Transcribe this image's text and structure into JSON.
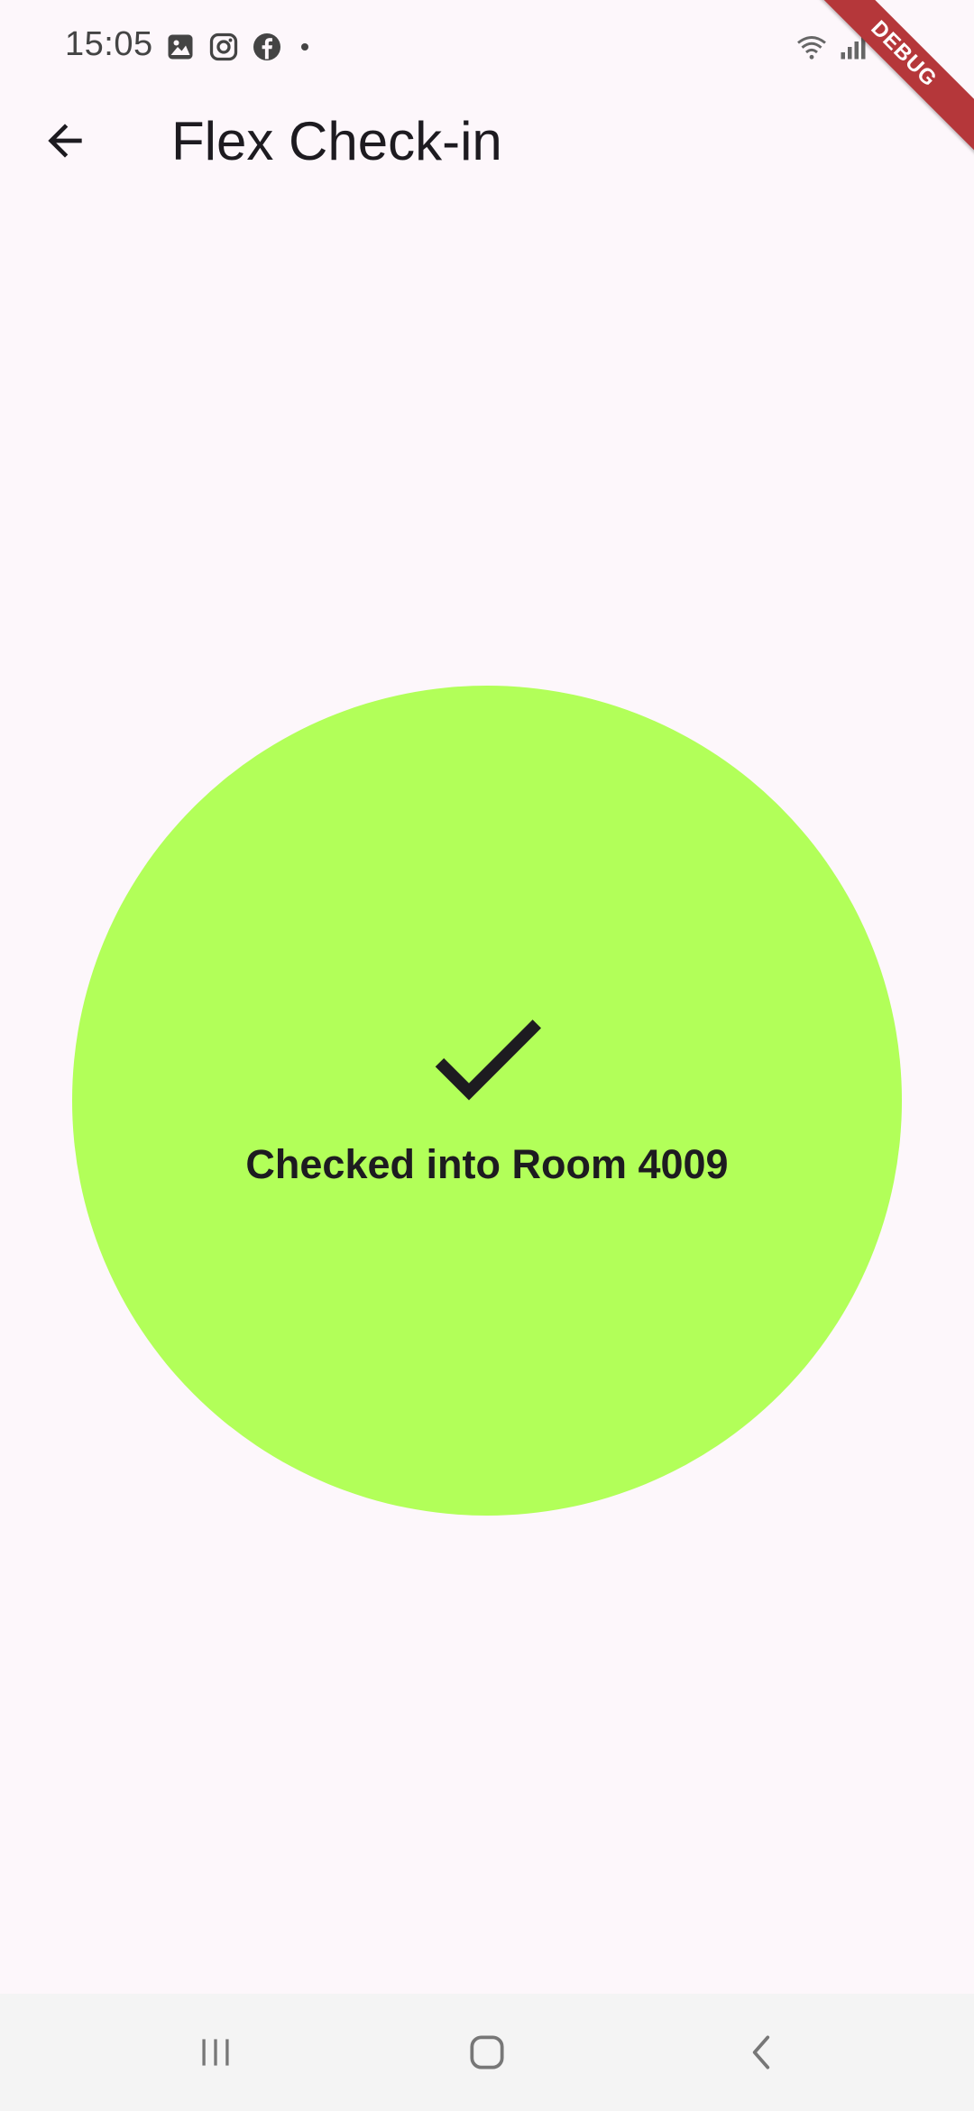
{
  "status_bar": {
    "time": "15:05",
    "left_icons": [
      "gallery-icon",
      "instagram-icon",
      "facebook-icon",
      "dot-icon"
    ],
    "right_icons": [
      "wifi-icon",
      "signal-icon",
      "battery-icon"
    ]
  },
  "debug_banner": "DEBUG",
  "app_bar": {
    "title": "Flex Check-in",
    "back_icon": "arrow-back-icon"
  },
  "result": {
    "message": "Checked into Room 4009",
    "icon": "checkmark-icon",
    "circle_color": "#b2ff59"
  },
  "colors": {
    "background": "#fdf7fb",
    "text": "#1d1b20",
    "debug": "#b5373a"
  },
  "nav_bar": {
    "buttons": [
      "recent-apps-icon",
      "home-icon",
      "back-icon"
    ]
  }
}
